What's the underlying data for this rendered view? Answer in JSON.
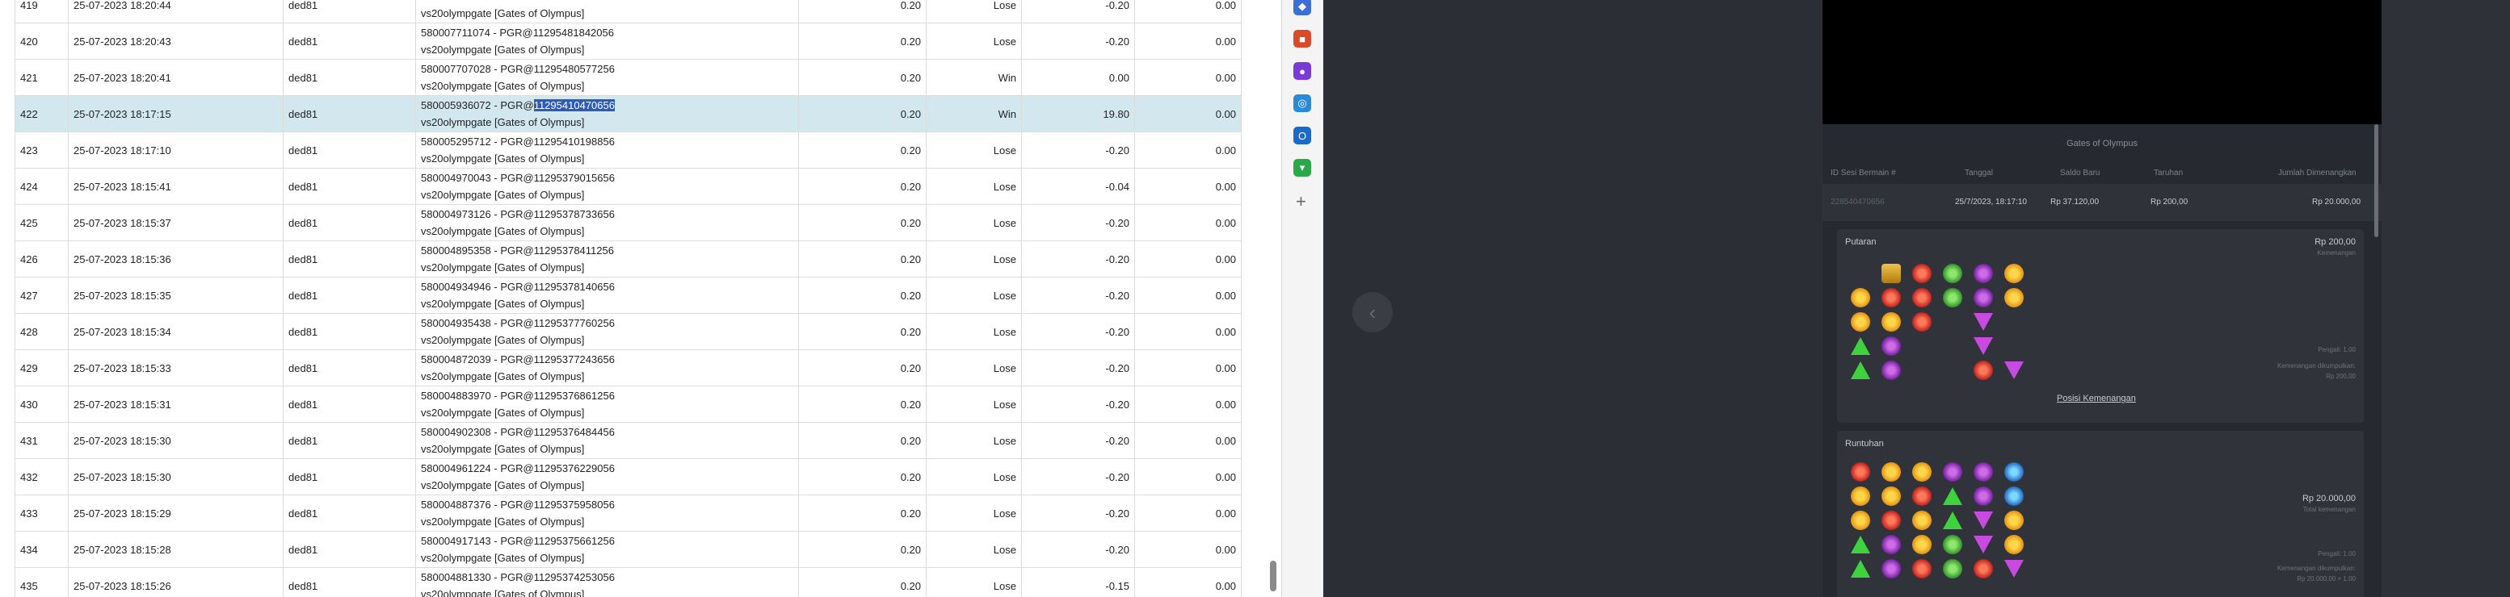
{
  "table": {
    "rows": [
      {
        "no": "419",
        "date": "25-07-2023 18:20:44",
        "user": "ded81",
        "game_line1": "",
        "game_line2": "vs20olympgate [Gates of Olympus]",
        "bet": "0.20",
        "result": "Lose",
        "win": "-0.20",
        "balance": "0.00"
      },
      {
        "no": "420",
        "date": "25-07-2023 18:20:43",
        "user": "ded81",
        "game_line1": "580007711074 - PGR@11295481842056",
        "game_line2": "vs20olympgate [Gates of Olympus]",
        "bet": "0.20",
        "result": "Lose",
        "win": "-0.20",
        "balance": "0.00"
      },
      {
        "no": "421",
        "date": "25-07-2023 18:20:41",
        "user": "ded81",
        "game_line1": "580007707028 - PGR@11295480577256",
        "game_line2": "vs20olympgate [Gates of Olympus]",
        "bet": "0.20",
        "result": "Win",
        "win": "0.00",
        "balance": "0.00"
      },
      {
        "no": "422",
        "date": "25-07-2023 18:17:15",
        "user": "ded81",
        "game_line1": "580005936072 - PGR@",
        "game_sel": "11295410470656",
        "game_line2": "vs20olympgate [Gates of Olympus]",
        "bet": "0.20",
        "result": "Win",
        "win": "19.80",
        "balance": "0.00",
        "highlight": true
      },
      {
        "no": "423",
        "date": "25-07-2023 18:17:10",
        "user": "ded81",
        "game_line1": "580005295712 - PGR@11295410198856",
        "game_line2": "vs20olympgate [Gates of Olympus]",
        "bet": "0.20",
        "result": "Lose",
        "win": "-0.20",
        "balance": "0.00"
      },
      {
        "no": "424",
        "date": "25-07-2023 18:15:41",
        "user": "ded81",
        "game_line1": "580004970043 - PGR@11295379015656",
        "game_line2": "vs20olympgate [Gates of Olympus]",
        "bet": "0.20",
        "result": "Lose",
        "win": "-0.04",
        "balance": "0.00"
      },
      {
        "no": "425",
        "date": "25-07-2023 18:15:37",
        "user": "ded81",
        "game_line1": "580004973126 - PGR@11295378733656",
        "game_line2": "vs20olympgate [Gates of Olympus]",
        "bet": "0.20",
        "result": "Lose",
        "win": "-0.20",
        "balance": "0.00"
      },
      {
        "no": "426",
        "date": "25-07-2023 18:15:36",
        "user": "ded81",
        "game_line1": "580004895358 - PGR@11295378411256",
        "game_line2": "vs20olympgate [Gates of Olympus]",
        "bet": "0.20",
        "result": "Lose",
        "win": "-0.20",
        "balance": "0.00"
      },
      {
        "no": "427",
        "date": "25-07-2023 18:15:35",
        "user": "ded81",
        "game_line1": "580004934946 - PGR@11295378140656",
        "game_line2": "vs20olympgate [Gates of Olympus]",
        "bet": "0.20",
        "result": "Lose",
        "win": "-0.20",
        "balance": "0.00"
      },
      {
        "no": "428",
        "date": "25-07-2023 18:15:34",
        "user": "ded81",
        "game_line1": "580004935438 - PGR@11295377760256",
        "game_line2": "vs20olympgate [Gates of Olympus]",
        "bet": "0.20",
        "result": "Lose",
        "win": "-0.20",
        "balance": "0.00"
      },
      {
        "no": "429",
        "date": "25-07-2023 18:15:33",
        "user": "ded81",
        "game_line1": "580004872039 - PGR@11295377243656",
        "game_line2": "vs20olympgate [Gates of Olympus]",
        "bet": "0.20",
        "result": "Lose",
        "win": "-0.20",
        "balance": "0.00"
      },
      {
        "no": "430",
        "date": "25-07-2023 18:15:31",
        "user": "ded81",
        "game_line1": "580004883970 - PGR@11295376861256",
        "game_line2": "vs20olympgate [Gates of Olympus]",
        "bet": "0.20",
        "result": "Lose",
        "win": "-0.20",
        "balance": "0.00"
      },
      {
        "no": "431",
        "date": "25-07-2023 18:15:30",
        "user": "ded81",
        "game_line1": "580004902308 - PGR@11295376484456",
        "game_line2": "vs20olympgate [Gates of Olympus]",
        "bet": "0.20",
        "result": "Lose",
        "win": "-0.20",
        "balance": "0.00"
      },
      {
        "no": "432",
        "date": "25-07-2023 18:15:30",
        "user": "ded81",
        "game_line1": "580004961224 - PGR@11295376229056",
        "game_line2": "vs20olympgate [Gates of Olympus]",
        "bet": "0.20",
        "result": "Lose",
        "win": "-0.20",
        "balance": "0.00"
      },
      {
        "no": "433",
        "date": "25-07-2023 18:15:29",
        "user": "ded81",
        "game_line1": "580004887376 - PGR@11295375958056",
        "game_line2": "vs20olympgate [Gates of Olympus]",
        "bet": "0.20",
        "result": "Lose",
        "win": "-0.20",
        "balance": "0.00"
      },
      {
        "no": "434",
        "date": "25-07-2023 18:15:28",
        "user": "ded81",
        "game_line1": "580004917143 - PGR@11295375661256",
        "game_line2": "vs20olympgate [Gates of Olympus]",
        "bet": "0.20",
        "result": "Lose",
        "win": "-0.20",
        "balance": "0.00"
      },
      {
        "no": "435",
        "date": "25-07-2023 18:15:26",
        "user": "ded81",
        "game_line1": "580004881330 - PGR@11295374253056",
        "game_line2": "vs20olympgate [Gates of Olympus]",
        "bet": "0.20",
        "result": "Lose",
        "win": "-0.15",
        "balance": "0.00"
      }
    ]
  },
  "sidebar": {
    "icons": [
      {
        "name": "tag-icon",
        "glyph": "◆",
        "color": "#3b6fd8"
      },
      {
        "name": "toolbox-icon",
        "glyph": "■",
        "color": "#d84a2a"
      },
      {
        "name": "user-add-icon",
        "glyph": "●",
        "color": "#7a3ad8"
      },
      {
        "name": "office-icon",
        "glyph": "◎",
        "color": "#2a8ad8"
      },
      {
        "name": "outlook-icon",
        "glyph": "O",
        "color": "#1a6ac8"
      },
      {
        "name": "shopping-cart-icon",
        "glyph": "▾",
        "color": "#2aa84a"
      }
    ],
    "plus": "+"
  },
  "viewer": {
    "back_glyph": "‹",
    "title": "Gates of Olympus",
    "headers": {
      "session_id": "ID Sesi Bermain #",
      "date": "Tanggal",
      "new_balance": "Saldo Baru",
      "bet": "Taruhan",
      "total_win": "Jumlah Dimenangkan"
    },
    "row": {
      "session_id": "228540470656",
      "date": "25/7/2023, 18:17:10",
      "new_balance": "Rp 37.120,00",
      "bet": "Rp 200,00",
      "total_win": "Rp 20.000,00"
    },
    "spin": {
      "title": "Putaran",
      "amount": "Rp 200,00",
      "amount_sub": "Kemenangan",
      "side1": "Pengali: 1.00",
      "side2": "Kemenangan dikumpulkan:",
      "side3": "Rp 200,00",
      "link": "Posisi Kemenangan"
    },
    "cascade": {
      "title": "Runtuhan",
      "amount": "Rp 20.000,00",
      "amount_sub": "Total kemenangan",
      "side1": "Pengali: 1.00",
      "side2": "Kemenangan dikumpulkan:",
      "side3": "Rp 20.000,00 × 1.00"
    },
    "grid1": [
      "",
      "c",
      "r",
      "g",
      "p",
      "o",
      "o",
      "r",
      "r",
      "g",
      "p",
      "o",
      "o",
      "o",
      "r",
      "",
      "dn",
      "",
      "up",
      "p",
      "",
      "",
      "dn",
      "",
      "up",
      "p",
      "",
      "",
      "r",
      "dn"
    ],
    "grid2": [
      "r",
      "o",
      "o",
      "p",
      "p",
      "b",
      "o",
      "o",
      "r",
      "up",
      "p",
      "b",
      "o",
      "r",
      "o",
      "up",
      "dn",
      "o",
      "up",
      "p",
      "o",
      "g",
      "dn",
      "o",
      "up",
      "p",
      "r",
      "g",
      "r",
      "dn"
    ]
  }
}
